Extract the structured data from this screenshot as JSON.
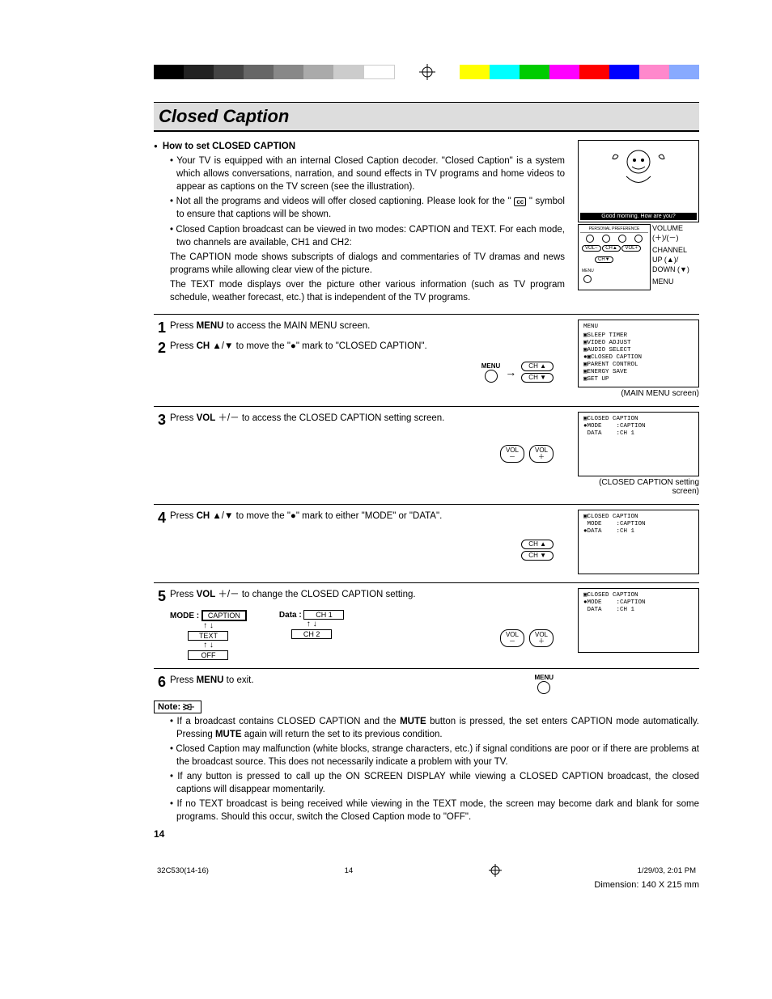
{
  "title": "Closed Caption",
  "intro": {
    "heading": "How to set CLOSED CAPTION",
    "b1": "Your TV is equipped with an internal Closed Caption decoder. \"Closed Caption\" is a system which allows conversations, narration, and sound effects in TV programs and home videos to appear as captions on the TV screen (see the illustration).",
    "b2a": "Not all the programs and videos will offer closed captioning. Please look for the \" ",
    "b2b": " \" symbol to ensure that captions will be shown.",
    "b3": "Closed Caption broadcast can be viewed in two modes: CAPTION and TEXT. For each mode, two channels are available, CH1 and CH2:",
    "p1": "The CAPTION mode shows subscripts of dialogs and commentaries of TV dramas and news programs while allowing clear view of the picture.",
    "p2": "The TEXT mode displays over the picture other various information (such as TV program schedule, weather forecast, etc.) that is independent of the TV programs."
  },
  "illus": {
    "speech": "Good morning. How are you?",
    "labels": {
      "volume": "VOLUME",
      "volplus": "(＋)/(－)",
      "channel": "CHANNEL",
      "up": "UP (▲)/",
      "down": "DOWN (▼)",
      "menu": "MENU"
    }
  },
  "steps": {
    "s1a": "Press ",
    "s1b": "MENU",
    "s1c": " to access the MAIN MENU screen.",
    "s2a": "Press ",
    "s2b": "CH",
    "s2c": " ▲/▼ to move the \"●\" mark to \"CLOSED CAPTION\".",
    "s3a": "Press ",
    "s3b": "VOL",
    "s3c": " ＋/－ to access the CLOSED CAPTION setting screen.",
    "s4a": "Press ",
    "s4b": "CH",
    "s4c": " ▲/▼ to move the \"●\" mark to either \"MODE\" or \"DATA\".",
    "s5a": "Press ",
    "s5b": "VOL",
    "s5c": " ＋/－ to change the CLOSED CAPTION setting.",
    "s6a": "Press ",
    "s6b": "MENU",
    "s6c": " to exit."
  },
  "buttons": {
    "menu": "MENU",
    "chup": "CH ▲",
    "chdown": "CH ▼",
    "volminus": "VOL\n－",
    "volplus": "VOL\n＋"
  },
  "main_menu": {
    "title": "MENU",
    "items": [
      "SLEEP TIMER",
      "VIDEO ADJUST",
      "AUDIO SELECT",
      "CLOSED CAPTION",
      "PARENT CONTROL",
      "ENERGY SAVE",
      "SET UP"
    ],
    "label": "(MAIN MENU screen)"
  },
  "cc_screen": {
    "title": "CLOSED CAPTION",
    "line1": "●MODE    :CAPTION",
    "line2": " DATA    :CH 1",
    "label": "(CLOSED CAPTION setting screen)"
  },
  "cc_screen2": {
    "title": "CLOSED CAPTION",
    "line1": " MODE    :CAPTION",
    "line2": "●DATA    :CH 1"
  },
  "cc_screen3": {
    "title": "CLOSED CAPTION",
    "line1": "●MODE    :CAPTION",
    "line2": " DATA    :CH 1"
  },
  "mode_diag": {
    "mode_label": "MODE :",
    "data_label": "Data :",
    "caption": "CAPTION",
    "text": "TEXT",
    "off": "OFF",
    "ch1": "CH 1",
    "ch2": "CH 2"
  },
  "note_label": "Note:",
  "notes": {
    "n1a": "If a broadcast contains CLOSED CAPTION and the ",
    "n1b": "MUTE",
    "n1c": " button is pressed, the set enters CAPTION mode automatically. Pressing ",
    "n1d": "MUTE",
    "n1e": " again will return the set to its previous condition.",
    "n2": "Closed Caption may malfunction (white blocks, strange characters, etc.) if signal conditions are poor or if there are problems at the broadcast source. This does not necessarily indicate a problem with your TV.",
    "n3": "If any button is pressed to call up the ON SCREEN DISPLAY while viewing a CLOSED CAPTION broadcast, the closed captions will disappear momentarily.",
    "n4": "If no TEXT broadcast is being received while viewing in the TEXT mode, the screen may become dark and blank for some programs. Should this occur, switch the Closed Caption mode to \"OFF\"."
  },
  "page_num": "14",
  "footer": {
    "file": "32C530(14-16)",
    "pg": "14",
    "ts": "1/29/03, 2:01 PM",
    "dim": "Dimension: 140  X 215 mm"
  },
  "cc_sym": "cc"
}
